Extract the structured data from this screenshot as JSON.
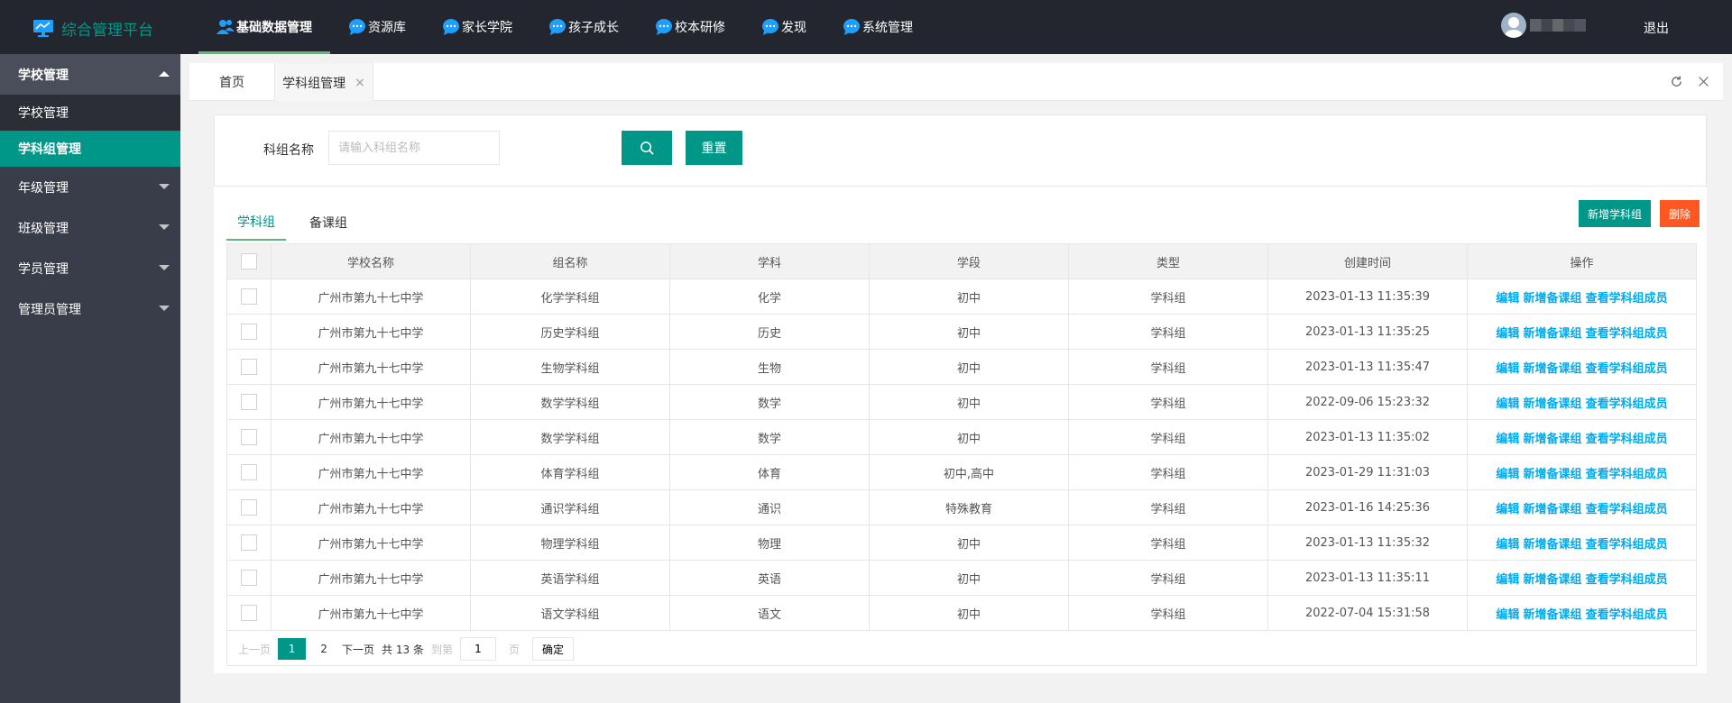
{
  "header": {
    "app_title": "综合管理平台",
    "nav": [
      {
        "label": "基础数据管理",
        "icon": "users-icon"
      },
      {
        "label": "资源库",
        "icon": "chat-bubble-icon"
      },
      {
        "label": "家长学院",
        "icon": "chat-bubble-icon"
      },
      {
        "label": "孩子成长",
        "icon": "chat-bubble-icon"
      },
      {
        "label": "校本研修",
        "icon": "chat-bubble-icon"
      },
      {
        "label": "发现",
        "icon": "chat-bubble-icon"
      },
      {
        "label": "系统管理",
        "icon": "chat-bubble-icon"
      }
    ],
    "logout": "退出",
    "accent_color": "#009688",
    "nav_active_underline": "#5fb878"
  },
  "sidebar": {
    "school_group": "学校管理",
    "school_items": [
      "学校管理",
      "学科组管理"
    ],
    "groups": [
      "年级管理",
      "班级管理",
      "学员管理",
      "管理员管理"
    ]
  },
  "page_tabs": {
    "home": "首页",
    "active": "学科组管理",
    "close_glyph": "×"
  },
  "search": {
    "label": "科组名称",
    "placeholder": "请输入科组名称",
    "reset": "重置"
  },
  "list": {
    "tabs": [
      "学科组",
      "备课组"
    ],
    "add_button": "新增学科组",
    "delete_button": "删除",
    "columns": [
      "学校名称",
      "组名称",
      "学科",
      "学段",
      "类型",
      "创建时间",
      "操作"
    ],
    "rows": [
      {
        "school": "广州市第九十七中学",
        "group": "化学学科组",
        "subject": "化学",
        "stage": "初中",
        "type": "学科组",
        "created": "2023-01-13 11:35:39"
      },
      {
        "school": "广州市第九十七中学",
        "group": "历史学科组",
        "subject": "历史",
        "stage": "初中",
        "type": "学科组",
        "created": "2023-01-13 11:35:25"
      },
      {
        "school": "广州市第九十七中学",
        "group": "生物学科组",
        "subject": "生物",
        "stage": "初中",
        "type": "学科组",
        "created": "2023-01-13 11:35:47"
      },
      {
        "school": "广州市第九十七中学",
        "group": "数学学科组",
        "subject": "数学",
        "stage": "初中",
        "type": "学科组",
        "created": "2022-09-06 15:23:32"
      },
      {
        "school": "广州市第九十七中学",
        "group": "数学学科组",
        "subject": "数学",
        "stage": "初中",
        "type": "学科组",
        "created": "2023-01-13 11:35:02"
      },
      {
        "school": "广州市第九十七中学",
        "group": "体育学科组",
        "subject": "体育",
        "stage": "初中,高中",
        "type": "学科组",
        "created": "2023-01-29 11:31:03"
      },
      {
        "school": "广州市第九十七中学",
        "group": "通识学科组",
        "subject": "通识",
        "stage": "特殊教育",
        "type": "学科组",
        "created": "2023-01-16 14:25:36"
      },
      {
        "school": "广州市第九十七中学",
        "group": "物理学科组",
        "subject": "物理",
        "stage": "初中",
        "type": "学科组",
        "created": "2023-01-13 11:35:32"
      },
      {
        "school": "广州市第九十七中学",
        "group": "英语学科组",
        "subject": "英语",
        "stage": "初中",
        "type": "学科组",
        "created": "2023-01-13 11:35:11"
      },
      {
        "school": "广州市第九十七中学",
        "group": "语文学科组",
        "subject": "语文",
        "stage": "初中",
        "type": "学科组",
        "created": "2022-07-04 15:31:58"
      }
    ],
    "row_actions": [
      "编辑",
      "新增备课组",
      "查看学科组成员"
    ]
  },
  "pagination": {
    "prev": "上一页",
    "pages": [
      "1",
      "2"
    ],
    "current": "1",
    "next": "下一页",
    "total": "共 13 条",
    "goto": "到第",
    "goto_value": "1",
    "unit": "页",
    "confirm": "确定"
  }
}
